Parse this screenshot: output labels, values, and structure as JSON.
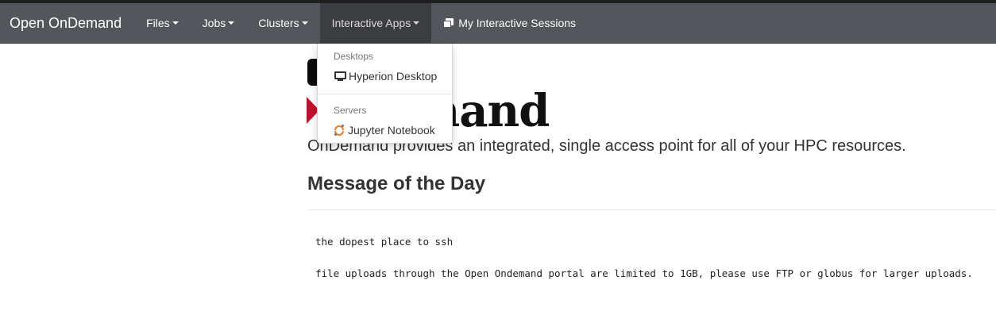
{
  "colors": {
    "navbar_bg": "#53565a",
    "navbar_active_bg": "#3b3d40",
    "logo_red": "#c0112e",
    "jupyter_orange": "#f37726"
  },
  "navbar": {
    "brand": "Open OnDemand",
    "items": [
      {
        "label": "Files",
        "has_caret": true
      },
      {
        "label": "Jobs",
        "has_caret": true
      },
      {
        "label": "Clusters",
        "has_caret": true
      },
      {
        "label": "Interactive Apps",
        "has_caret": true,
        "active": true
      },
      {
        "label": "My Interactive Sessions",
        "icon": "sessions-icon"
      }
    ]
  },
  "dropdown": {
    "sections": [
      {
        "header": "Desktops",
        "items": [
          {
            "label": "Hyperion Desktop",
            "icon": "desktop-icon"
          }
        ]
      },
      {
        "header": "Servers",
        "items": [
          {
            "label": "Jupyter Notebook",
            "icon": "jupyter-icon"
          }
        ]
      }
    ]
  },
  "main": {
    "logo_text": "mand",
    "tagline": "OnDemand provides an integrated, single access point for all of your HPC resources.",
    "motd_title": "Message of the Day",
    "motd_lines": [
      "the dopest place to ssh",
      "file uploads through the Open Ondemand portal are limited to 1GB, please use FTP or globus for larger uploads."
    ]
  }
}
